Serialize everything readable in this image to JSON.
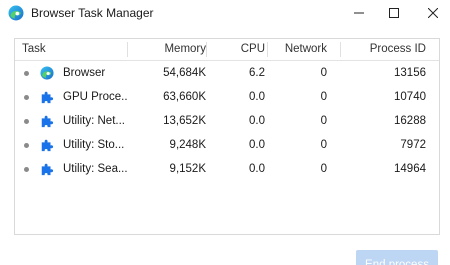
{
  "window": {
    "title": "Browser Task Manager"
  },
  "table": {
    "columns": [
      "Task",
      "Memory",
      "CPU",
      "Network",
      "Process ID"
    ],
    "rows": [
      {
        "icon": "browser-icon",
        "task": "Browser",
        "memory": "54,684K",
        "cpu": "6.2",
        "network": "0",
        "pid": "13156"
      },
      {
        "icon": "puzzle-icon",
        "task": "GPU Proce...",
        "memory": "63,660K",
        "cpu": "0.0",
        "network": "0",
        "pid": "10740"
      },
      {
        "icon": "puzzle-icon",
        "task": "Utility: Net...",
        "memory": "13,652K",
        "cpu": "0.0",
        "network": "0",
        "pid": "16288"
      },
      {
        "icon": "puzzle-icon",
        "task": "Utility: Sto...",
        "memory": "9,248K",
        "cpu": "0.0",
        "network": "0",
        "pid": "7972"
      },
      {
        "icon": "puzzle-icon",
        "task": "Utility: Sea...",
        "memory": "9,152K",
        "cpu": "0.0",
        "network": "0",
        "pid": "14964"
      }
    ]
  },
  "footer": {
    "end_process_label": "End process"
  },
  "colors": {
    "accent": "#1a73e8",
    "button_disabled": "#bcd6f4"
  }
}
